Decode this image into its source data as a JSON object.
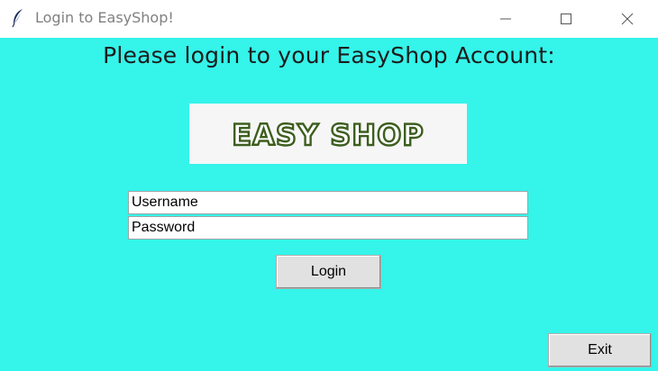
{
  "window": {
    "title": "Login to EasyShop!",
    "icon": "feather-icon",
    "controls": {
      "minimize": "minimize-icon",
      "maximize": "maximize-icon",
      "close": "close-icon"
    }
  },
  "main": {
    "heading": "Please login to your EasyShop Account:",
    "logo_text": "EASY SHOP",
    "background_color": "#35f4ea",
    "username_value": "Username",
    "password_value": "Password",
    "login_label": "Login",
    "exit_label": "Exit"
  }
}
